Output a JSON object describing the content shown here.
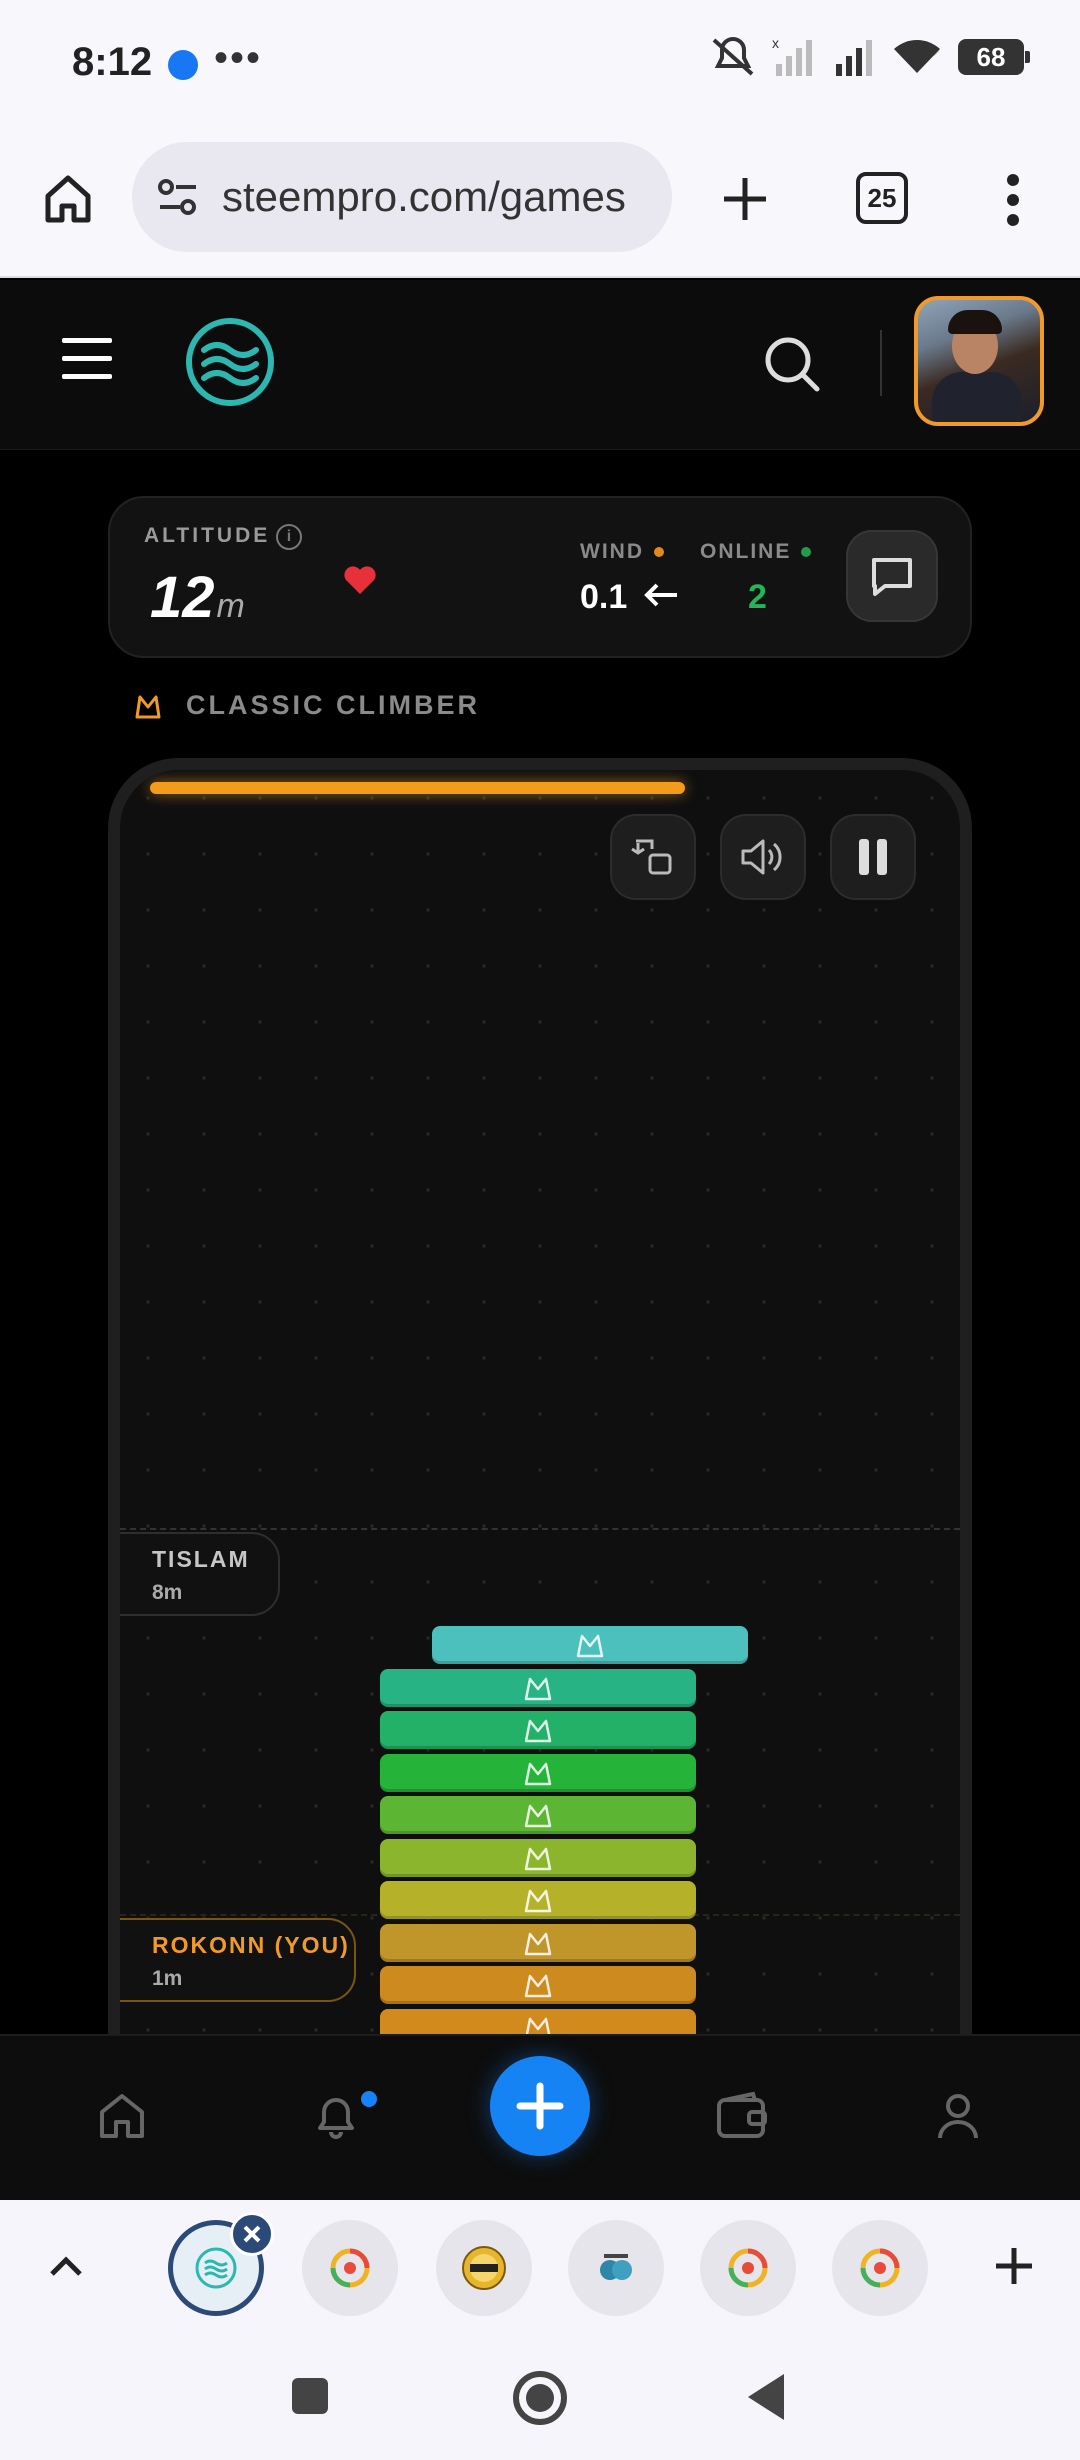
{
  "status_bar": {
    "time": "8:12",
    "battery": "68"
  },
  "browser": {
    "url": "steempro.com/games",
    "tab_count": "25"
  },
  "stats": {
    "altitude_label": "ALTITUDE",
    "altitude_value": "12",
    "altitude_unit": "m",
    "wind_label": "WIND",
    "wind_value": "0.1",
    "online_label": "ONLINE",
    "online_value": "2",
    "colors": {
      "wind_dot": "#e08a1e",
      "online_dot": "#1f9d4c",
      "online_value": "#22b55a",
      "heart": "#e8303a"
    }
  },
  "mode": {
    "label": "CLASSIC CLIMBER",
    "icon": "mountain-icon"
  },
  "game": {
    "progress": 0.66,
    "progress_color": "#f39b1a",
    "buttons": [
      "swap-icon",
      "volume-icon",
      "pause-icon"
    ],
    "players": [
      {
        "name": "TISLAM",
        "altitude": "8m"
      },
      {
        "name": "ROKONN (YOU)",
        "altitude": "1m"
      }
    ],
    "block_colors": [
      "#4cc0bd",
      "#27b384",
      "#23b167",
      "#25b33a",
      "#5cb634",
      "#8cb52e",
      "#b5b22a",
      "#c0952a",
      "#cd8a1e",
      "#d28a1c"
    ]
  },
  "bottom_nav": {
    "items": [
      "home-icon",
      "bell-icon",
      "plus-icon",
      "wallet-icon",
      "user-icon"
    ],
    "accent": "#1683f5"
  },
  "tab_strip": {
    "tabs": [
      "steempro-tab",
      "coin-tab",
      "steem-tab",
      "brain-tab",
      "coin-tab",
      "coin-tab"
    ]
  }
}
